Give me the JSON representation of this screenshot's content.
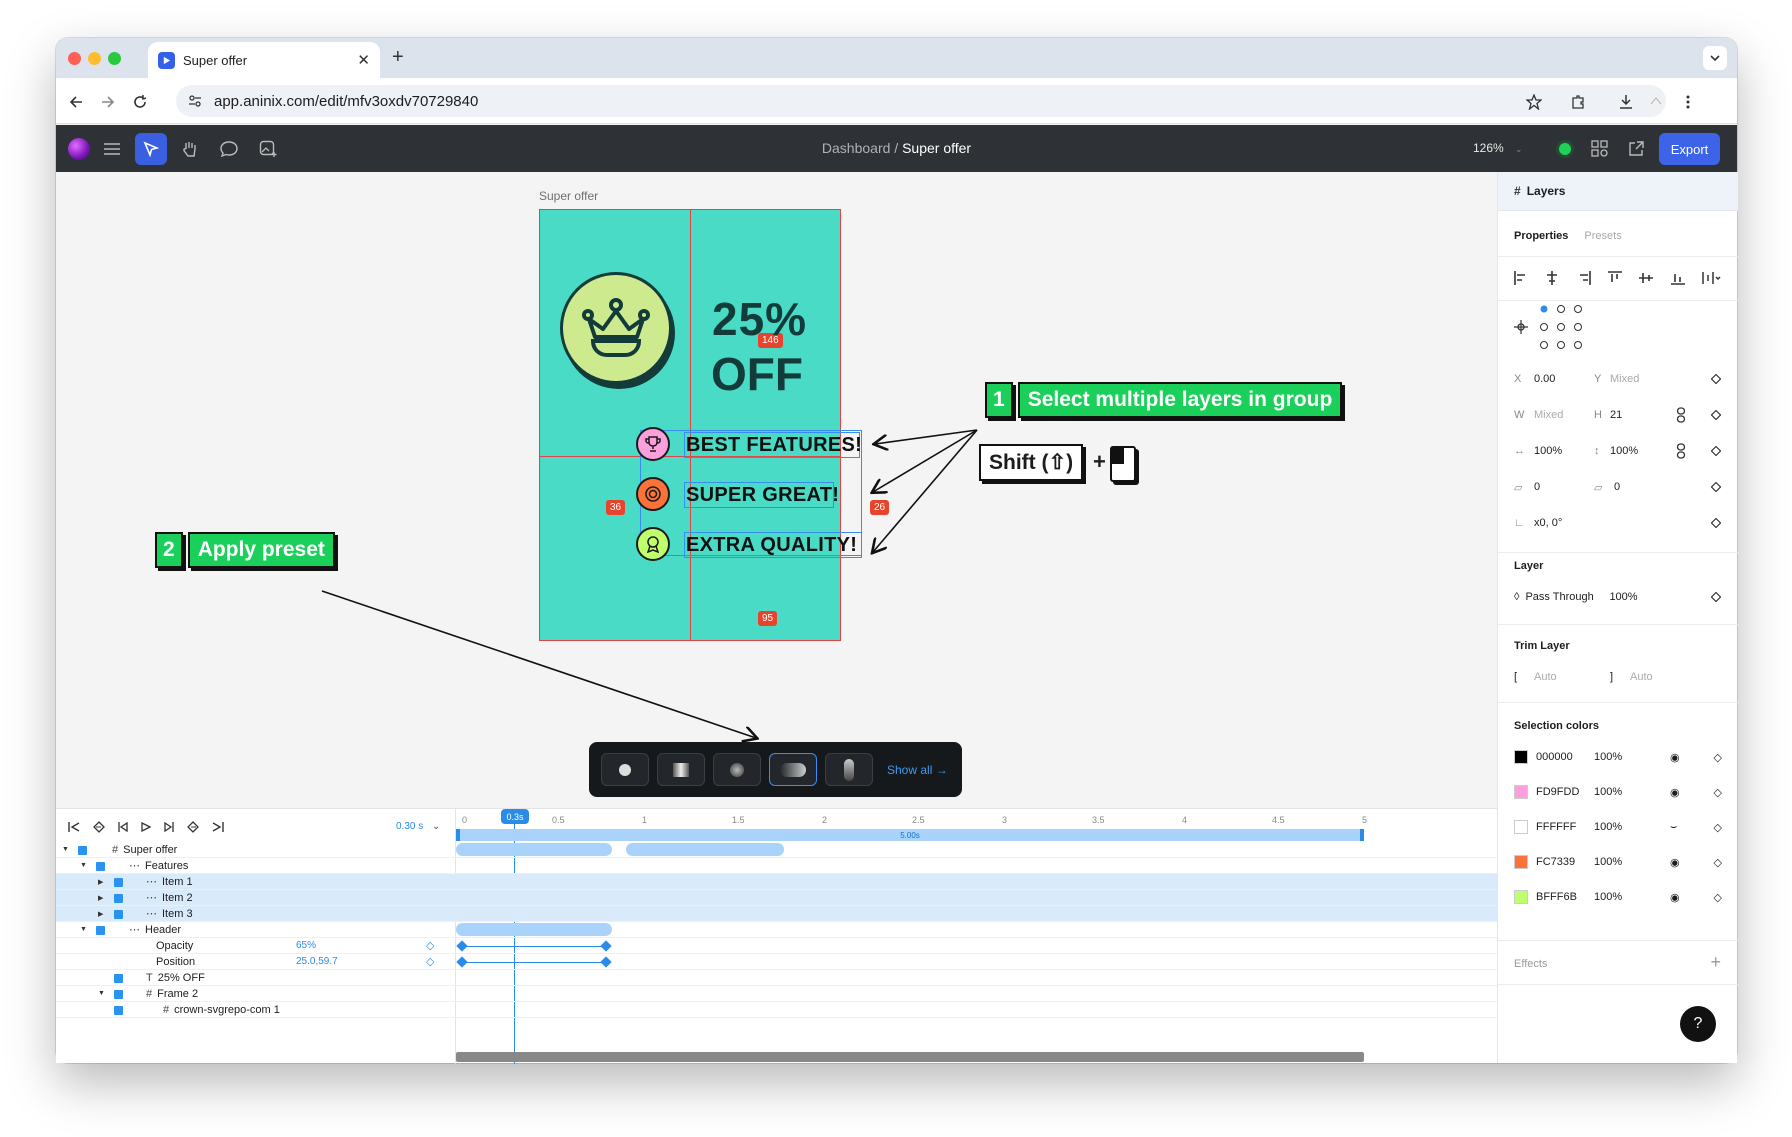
{
  "browser": {
    "tab_title": "Super offer",
    "url": "app.aninix.com/edit/mfv3oxdv70729840"
  },
  "toolbar": {
    "breadcrumb_parent": "Dashboard",
    "breadcrumb_sep": "/",
    "breadcrumb_current": "Super offer",
    "zoom": "126%",
    "export_label": "Export"
  },
  "canvas": {
    "frame_label": "Super offer",
    "headline_pct": "25%",
    "headline_off": "OFF",
    "features": [
      "BEST FEATURES!",
      "SUPER GREAT!",
      "EXTRA QUALITY!"
    ],
    "badges": {
      "top": "146",
      "left": "36",
      "right": "26",
      "bottom": "95"
    },
    "callout1_num": "1",
    "callout1_text": "Select multiple layers in group",
    "shift_text": "Shift (⇧)",
    "plus": "+",
    "callout2_num": "2",
    "callout2_text": "Apply preset",
    "show_all": "Show all →"
  },
  "panel": {
    "tab_layers": "Layers",
    "tab_properties": "Properties",
    "tab_presets": "Presets",
    "x_label": "X",
    "x_value": "0.00",
    "y_label": "Y",
    "y_value": "Mixed",
    "w_label": "W",
    "w_value": "Mixed",
    "h_label": "H",
    "h_value": "21",
    "scale_x": "100%",
    "scale_y": "100%",
    "skew": "0",
    "radius": "0",
    "origin": "x0, 0°",
    "layer_title": "Layer",
    "blend": "Pass Through",
    "layer_opacity": "100%",
    "trim_title": "Trim Layer",
    "trim_start": "Auto",
    "trim_end": "Auto",
    "colors_title": "Selection colors",
    "colors": [
      {
        "hex": "000000",
        "color": "#000000",
        "opacity": "100%"
      },
      {
        "hex": "FD9FDD",
        "color": "#FD9FDD",
        "opacity": "100%"
      },
      {
        "hex": "FFFFFF",
        "color": "#FFFFFF",
        "opacity": "100%"
      },
      {
        "hex": "FC7339",
        "color": "#FC7339",
        "opacity": "100%"
      },
      {
        "hex": "BFFF6B",
        "color": "#BFFF6B",
        "opacity": "100%"
      }
    ],
    "effects_title": "Effects",
    "help": "?"
  },
  "timeline": {
    "time_readout": "0.30 s",
    "playhead": "0.3s",
    "duration": "5.00s",
    "ticks": [
      "0",
      "0.5",
      "1",
      "1.5",
      "2",
      "2.5",
      "3",
      "3.5",
      "4",
      "4.5",
      "5"
    ],
    "layers": [
      "Super offer",
      "Features",
      "Item 1",
      "Item 2",
      "Item 3",
      "Header",
      "Opacity",
      "Position",
      "25% OFF",
      "Frame 2",
      "crown-svgrepo-com 1"
    ],
    "opacity_value": "65%",
    "position_value": "25.0,59.7"
  }
}
